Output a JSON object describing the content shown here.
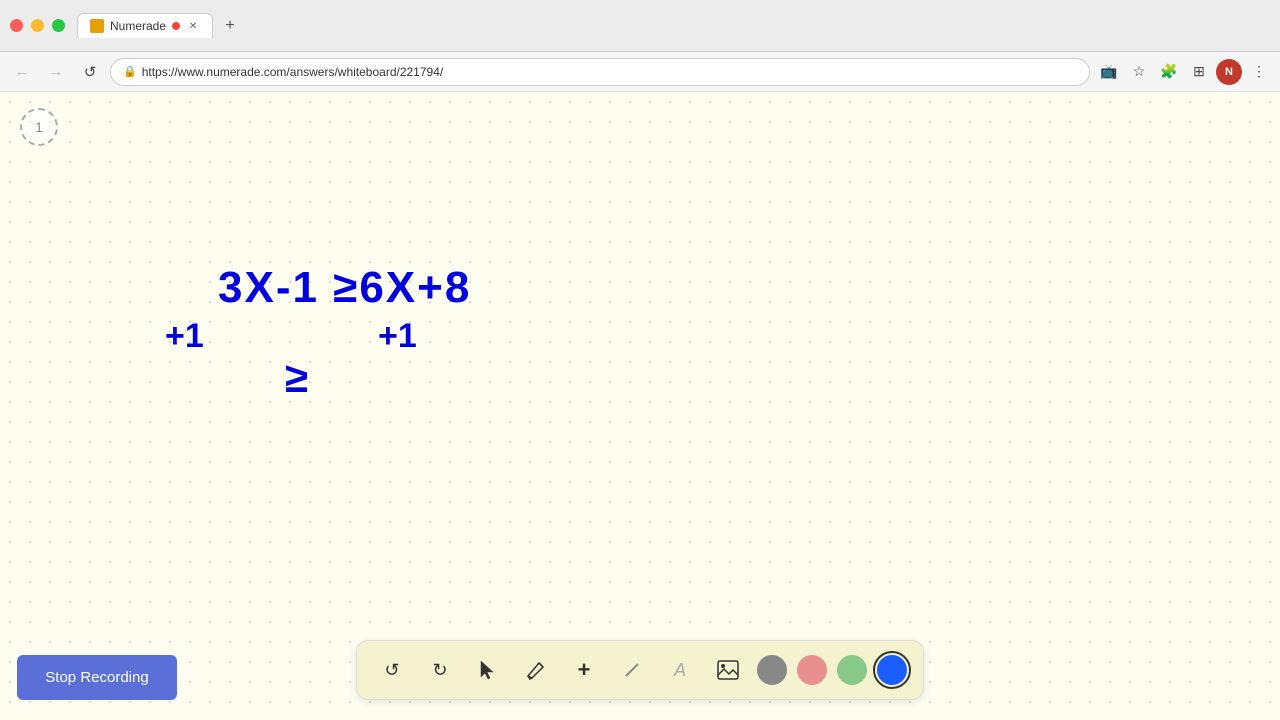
{
  "browser": {
    "tab_title": "Numerade",
    "tab_url": "https://www.numerade.com/answers/whiteboard/221794/",
    "new_tab_label": "+",
    "nav": {
      "back_label": "←",
      "forward_label": "→",
      "refresh_label": "↺",
      "address": "https://www.numerade.com/answers/whiteboard/221794/"
    }
  },
  "page_indicator": "1",
  "math": {
    "line1": "3X-1 ≥6X+8",
    "line2_left": "+1",
    "line2_right": "+1",
    "line3": "≥"
  },
  "toolbar": {
    "undo_label": "↺",
    "redo_label": "↻",
    "select_label": "↖",
    "pen_label": "✏",
    "plus_label": "+",
    "eraser_label": "/",
    "text_label": "A",
    "image_label": "🖼",
    "colors": [
      {
        "name": "gray",
        "hex": "#888888",
        "active": false
      },
      {
        "name": "pink",
        "hex": "#e89090",
        "active": false
      },
      {
        "name": "green",
        "hex": "#88c888",
        "active": false
      },
      {
        "name": "blue",
        "hex": "#1a5eff",
        "active": true
      }
    ]
  },
  "stop_recording": {
    "label": "Stop Recording"
  }
}
